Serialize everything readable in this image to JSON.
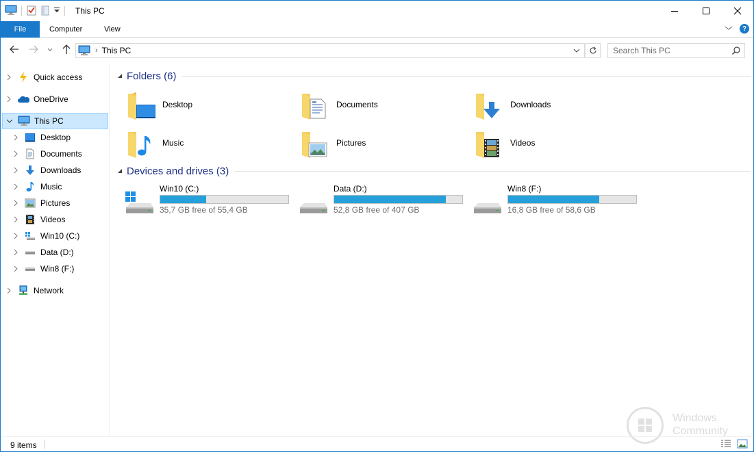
{
  "title": "This PC",
  "window_controls": {
    "minimize": "—",
    "maximize": "☐",
    "close": "✕"
  },
  "ribbon": {
    "tabs": [
      "File",
      "Computer",
      "View"
    ],
    "help": "?"
  },
  "address": {
    "path": "This PC",
    "separator": "›"
  },
  "search": {
    "placeholder": "Search This PC"
  },
  "nav": {
    "items": [
      {
        "label": "Quick access",
        "icon": "quick-access-icon"
      },
      {
        "label": "OneDrive",
        "icon": "onedrive-icon"
      },
      {
        "label": "This PC",
        "icon": "this-pc-icon",
        "expanded": true,
        "selected": true
      },
      {
        "label": "Desktop",
        "icon": "desktop-icon"
      },
      {
        "label": "Documents",
        "icon": "documents-icon"
      },
      {
        "label": "Downloads",
        "icon": "downloads-icon"
      },
      {
        "label": "Music",
        "icon": "music-icon"
      },
      {
        "label": "Pictures",
        "icon": "pictures-icon"
      },
      {
        "label": "Videos",
        "icon": "videos-icon"
      },
      {
        "label": "Win10 (C:)",
        "icon": "windows-drive-icon"
      },
      {
        "label": "Data (D:)",
        "icon": "drive-icon"
      },
      {
        "label": "Win8 (F:)",
        "icon": "drive-icon"
      },
      {
        "label": "Network",
        "icon": "network-icon"
      }
    ]
  },
  "folders": {
    "title": "Folders (6)",
    "items": [
      {
        "label": "Desktop",
        "overlay": "desktop"
      },
      {
        "label": "Documents",
        "overlay": "documents"
      },
      {
        "label": "Downloads",
        "overlay": "downloads"
      },
      {
        "label": "Music",
        "overlay": "music"
      },
      {
        "label": "Pictures",
        "overlay": "pictures"
      },
      {
        "label": "Videos",
        "overlay": "videos"
      }
    ]
  },
  "drives": {
    "title": "Devices and drives (3)",
    "items": [
      {
        "name": "Win10 (C:)",
        "free_text": "35,7 GB free of 55,4 GB",
        "used_fraction": 0.356,
        "windows_logo": true
      },
      {
        "name": "Data (D:)",
        "free_text": "52,8 GB free of 407 GB",
        "used_fraction": 0.87,
        "windows_logo": false
      },
      {
        "name": "Win8 (F:)",
        "free_text": "16,8 GB free of 58,6 GB",
        "used_fraction": 0.713,
        "windows_logo": false
      }
    ]
  },
  "status": {
    "item_count": "9 items"
  },
  "watermark": {
    "line1": "Windows",
    "line2": "Community"
  },
  "colors": {
    "accent": "#1979ca",
    "folder": "#f0c64b",
    "drive_bar": "#26a0da",
    "group_title": "#1e3287",
    "selection": "#cce8ff"
  }
}
